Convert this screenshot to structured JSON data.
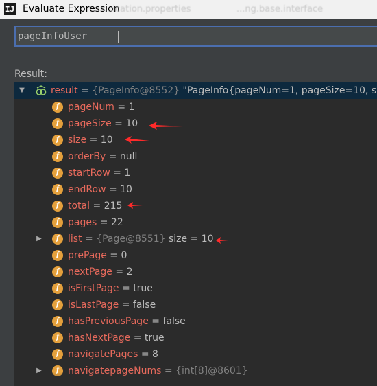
{
  "window": {
    "title": "Evaluate Expression",
    "app_icon": "IJ",
    "background_tabs": [
      "...ication.properties",
      "...ng.base.interface"
    ]
  },
  "expression": {
    "value": "pageInfoUser"
  },
  "result": {
    "label": "Result:",
    "root": {
      "name": "result",
      "eq": " = ",
      "ref": "{PageInfo@8552}",
      "text": " \"PageInfo{pageNum=1, pageSize=10, s"
    },
    "fields": [
      {
        "name": "pageNum",
        "value": "1"
      },
      {
        "name": "pageSize",
        "value": "10"
      },
      {
        "name": "size",
        "value": "10"
      },
      {
        "name": "orderBy",
        "value": "null"
      },
      {
        "name": "startRow",
        "value": "1"
      },
      {
        "name": "endRow",
        "value": "10"
      },
      {
        "name": "total",
        "value": "215"
      },
      {
        "name": "pages",
        "value": "22"
      },
      {
        "name": "list",
        "ref": "{Page@8551}",
        "extra": "size = 10"
      },
      {
        "name": "prePage",
        "value": "0"
      },
      {
        "name": "nextPage",
        "value": "2"
      },
      {
        "name": "isFirstPage",
        "value": "true"
      },
      {
        "name": "isLastPage",
        "value": "false"
      },
      {
        "name": "hasPreviousPage",
        "value": "false"
      },
      {
        "name": "hasNextPage",
        "value": "true"
      },
      {
        "name": "navigatePages",
        "value": "8"
      },
      {
        "name": "navigatepageNums",
        "ref": "{int[8]@8601}"
      }
    ]
  },
  "colors": {
    "background": "#3c3f41",
    "tree_background": "#2b2b2b",
    "field_name": "#e86a5c",
    "field_icon": "#e4a03c",
    "annotation_arrow": "#ff2a2a",
    "focus_border": "#4b6eaf"
  },
  "icons": {
    "app": "intellij-icon",
    "field": "field-icon",
    "result": "watch-result-icon",
    "expand": "triangle-right-icon",
    "collapse": "triangle-down-icon"
  }
}
